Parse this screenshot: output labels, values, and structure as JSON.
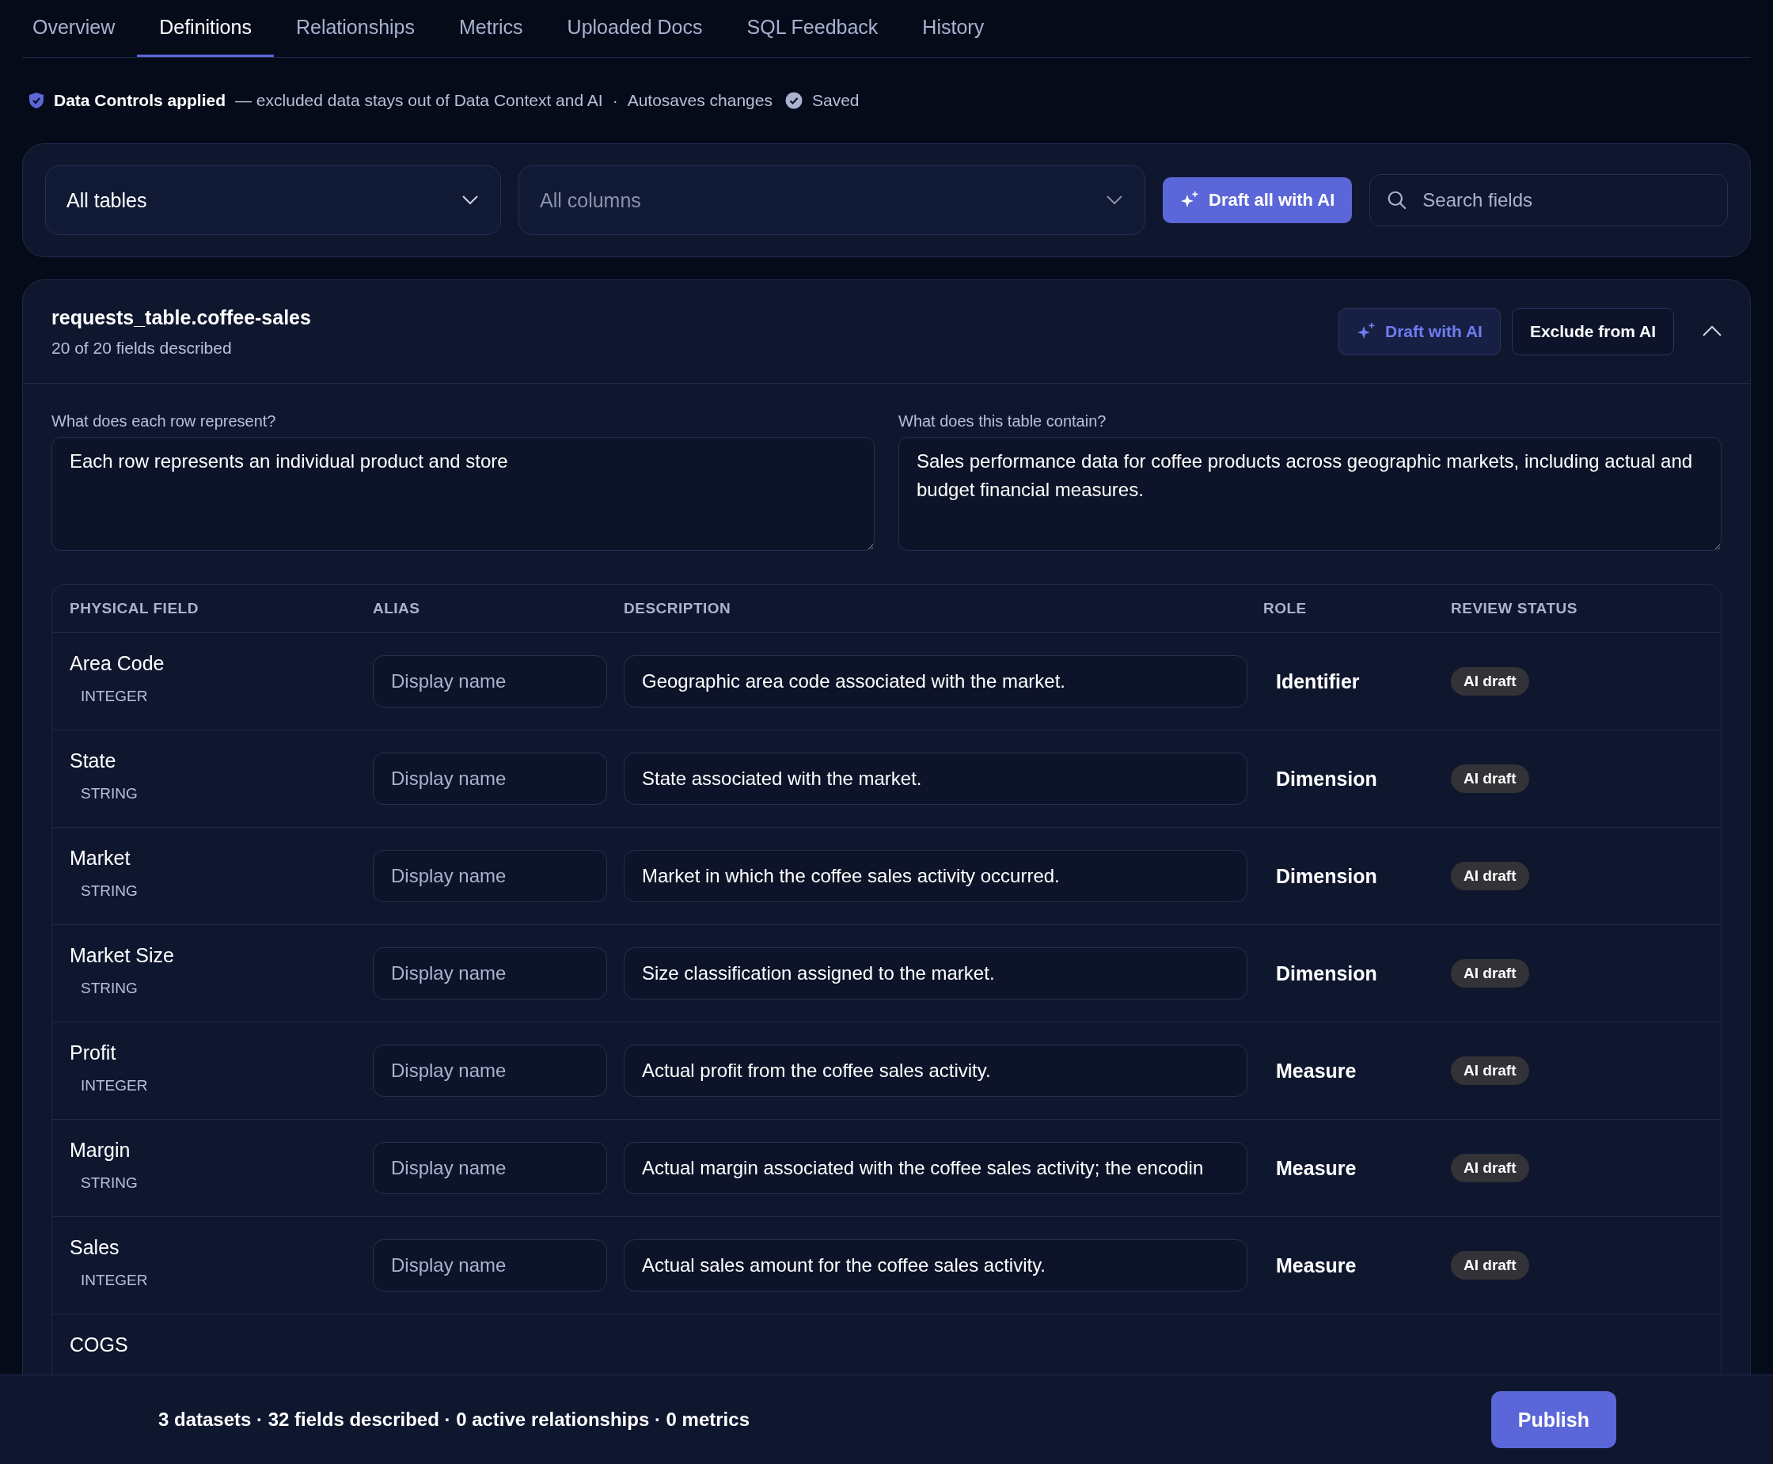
{
  "tabs": [
    {
      "label": "Overview",
      "selected": false
    },
    {
      "label": "Definitions",
      "selected": true
    },
    {
      "label": "Relationships",
      "selected": false
    },
    {
      "label": "Metrics",
      "selected": false
    },
    {
      "label": "Uploaded Docs",
      "selected": false
    },
    {
      "label": "SQL Feedback",
      "selected": false
    },
    {
      "label": "History",
      "selected": false
    }
  ],
  "status_line": {
    "title": "Data Controls applied",
    "note": "— excluded data stays out of Data Context and AI",
    "separator": "·",
    "autosave": "Autosaves changes",
    "saved": "Saved"
  },
  "filters": {
    "tables": "All tables",
    "columns": "All columns",
    "draft_button": "Draft all with AI",
    "search": {
      "placeholder": "Search fields"
    }
  },
  "dataset": {
    "name": "requests_table.coffee-sales",
    "summary": "20 of 20 fields described",
    "expanded": true,
    "draft_button": "Draft with AI",
    "exclude_button": "Exclude from AI",
    "row_question": {
      "label": "What does each row represent?",
      "value": "Each row represents an individual product and store"
    },
    "contents_question": {
      "label": "What does this table contain?",
      "value": "Sales performance data for coffee products across geographic markets, including actual and budget financial measures."
    },
    "table": {
      "columns": [
        "PHYSICAL FIELD",
        "ALIAS",
        "DESCRIPTION",
        "ROLE",
        "REVIEW STATUS"
      ],
      "rows": [
        {
          "field": "Area Code",
          "type": "INTEGER",
          "alias_placeholder": "Display name",
          "description": "Geographic area code associated with the market.",
          "role": "Identifier",
          "status": "AI draft"
        },
        {
          "field": "State",
          "type": "STRING",
          "alias_placeholder": "Display name",
          "description": "State associated with the market.",
          "role": "Dimension",
          "status": "AI draft"
        },
        {
          "field": "Market",
          "type": "STRING",
          "alias_placeholder": "Display name",
          "description": "Market in which the coffee sales activity occurred.",
          "role": "Dimension",
          "status": "AI draft"
        },
        {
          "field": "Market Size",
          "type": "STRING",
          "alias_placeholder": "Display name",
          "description": "Size classification assigned to the market.",
          "role": "Dimension",
          "status": "AI draft"
        },
        {
          "field": "Profit",
          "type": "INTEGER",
          "alias_placeholder": "Display name",
          "description": "Actual profit from the coffee sales activity.",
          "role": "Measure",
          "status": "AI draft"
        },
        {
          "field": "Margin",
          "type": "STRING",
          "alias_placeholder": "Display name",
          "description": "Actual margin associated with the coffee sales activity; the encodin",
          "role": "Measure",
          "status": "AI draft"
        },
        {
          "field": "Sales",
          "type": "INTEGER",
          "alias_placeholder": "Display name",
          "description": "Actual sales amount for the coffee sales activity.",
          "role": "Measure",
          "status": "AI draft"
        },
        {
          "field": "COGS"
        }
      ]
    }
  },
  "footer": {
    "summary": "3 datasets · 32 fields described · 0 active relationships · 0 metrics",
    "publish_button": "Publish"
  }
}
